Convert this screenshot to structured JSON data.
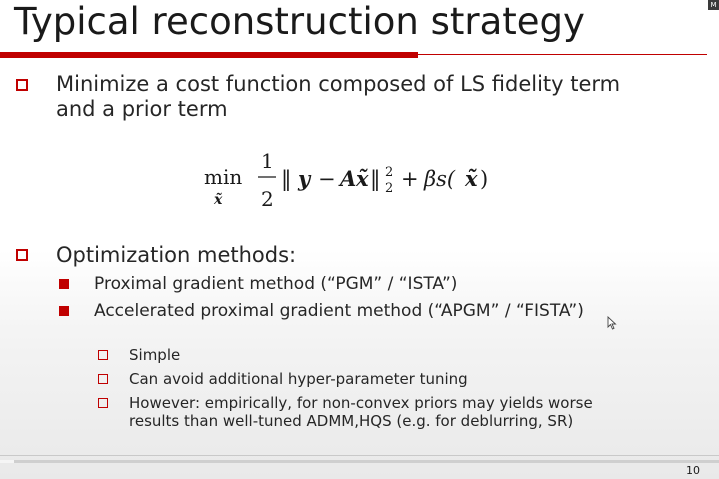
{
  "slide": {
    "title": "Typical reconstruction strategy",
    "page_number": "10",
    "logo_text": "M"
  },
  "bullets": [
    {
      "lines": [
        "Minimize a cost function composed of LS fidelity term",
        "and a prior term"
      ]
    },
    {
      "lines": [
        "Optimization methods:"
      ]
    }
  ],
  "methods": [
    "Proximal gradient method (“PGM” / “ISTA”)",
    "Accelerated proximal gradient method (“APGM” / “FISTA”)"
  ],
  "notes": [
    {
      "lines": [
        "Simple"
      ]
    },
    {
      "lines": [
        "Can avoid additional hyper-parameter tuning"
      ]
    },
    {
      "lines": [
        "However: empirically, for non-convex priors may yields worse",
        "results than well-tuned ADMM,HQS (e.g. for deblurring, SR)"
      ]
    }
  ],
  "formula": {
    "operator": "min",
    "subscript": "x̃",
    "frac_num": "1",
    "frac_den": "2",
    "norm_open": "‖",
    "y": "y",
    "minus": "−",
    "A": "A",
    "x": "x̃",
    "norm_close": "‖",
    "power": "2",
    "sub": "2",
    "plus": "+",
    "beta_s": "βs(",
    "x2": "x̃",
    "close": ")"
  },
  "video": {
    "progress": 0.02
  },
  "colors": {
    "accent": "#c00000",
    "text": "#262626"
  }
}
